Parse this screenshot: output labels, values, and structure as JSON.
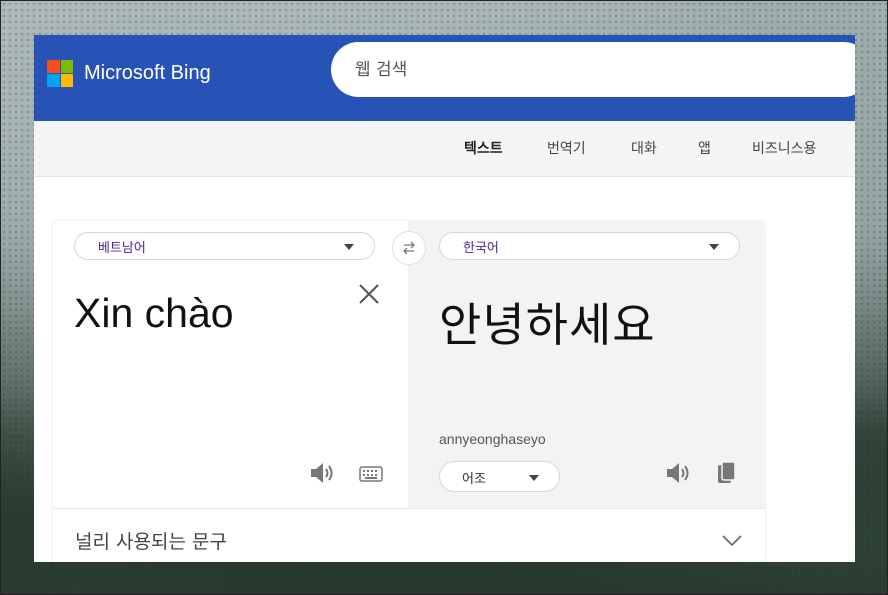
{
  "header": {
    "brand": "Microsoft Bing",
    "search_placeholder": "웹 검색"
  },
  "subnav": {
    "items": [
      "텍스트",
      "번역기",
      "대화",
      "앱",
      "비즈니스용"
    ],
    "active": "텍스트"
  },
  "translator": {
    "source_lang": "베트남어",
    "target_lang": "한국어",
    "source_text": "Xin chào",
    "target_text": "안녕하세요",
    "transliteration": "annyeonghaseyo",
    "tone": "어조"
  },
  "phrases": {
    "label": "널리 사용되는 문구"
  },
  "colors": {
    "header_bg": "#2853b6",
    "lang_label": "#4b2890",
    "target_pane_bg": "#f3f3f3"
  },
  "icons": [
    "microsoft-logo",
    "swap-icon",
    "close-icon",
    "speaker-icon",
    "keyboard-icon",
    "copy-icon",
    "chevron-down-icon"
  ]
}
